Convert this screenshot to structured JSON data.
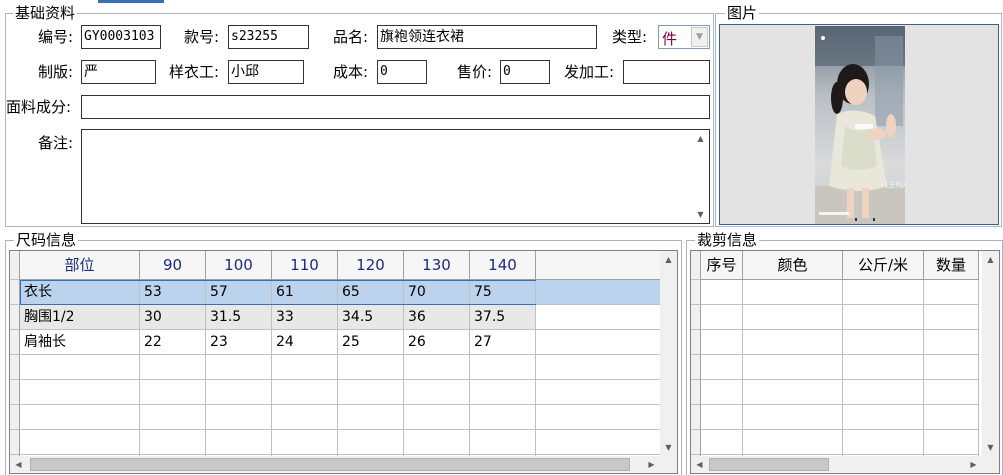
{
  "basic": {
    "legend": "基础资料",
    "fields": {
      "code_label": "编号:",
      "code_value": "GY0003103",
      "style_label": "款号:",
      "style_value": "s23255",
      "name_label": "品名:",
      "name_value": "旗袍领连衣裙",
      "type_label": "类型:",
      "type_value": "件",
      "pattern_label": "制版:",
      "pattern_value": "严",
      "sample_label": "样衣工:",
      "sample_value": "小邱",
      "cost_label": "成本:",
      "cost_value": "0",
      "price_label": "售价:",
      "price_value": "0",
      "outsource_label": "发加工:",
      "outsource_value": "",
      "fabric_label": "面料成分:",
      "fabric_value": "",
      "remark_label": "备注:",
      "remark_value": ""
    }
  },
  "picture": {
    "legend": "图片"
  },
  "size": {
    "legend": "尺码信息",
    "headers": [
      "部位",
      "90",
      "100",
      "110",
      "120",
      "130",
      "140"
    ],
    "rows": [
      [
        "衣长",
        "53",
        "57",
        "61",
        "65",
        "70",
        "75"
      ],
      [
        "胸围1/2",
        "30",
        "31.5",
        "33",
        "34.5",
        "36",
        "37.5"
      ],
      [
        "肩袖长",
        "22",
        "23",
        "24",
        "25",
        "26",
        "27"
      ]
    ],
    "selected_row": 0
  },
  "cut": {
    "legend": "裁剪信息",
    "headers": [
      "序号",
      "颜色",
      "公斤/米",
      "数量"
    ]
  },
  "colors": {
    "accent": "#3a5e9f",
    "header_text": "#1c2a80",
    "selected_row": "#bcd3ee",
    "alt_row": "#e8e8e8"
  },
  "icons": {
    "scroll_up": "scroll-up-arrow",
    "scroll_down": "scroll-down-arrow",
    "combo": "chevron-down"
  }
}
